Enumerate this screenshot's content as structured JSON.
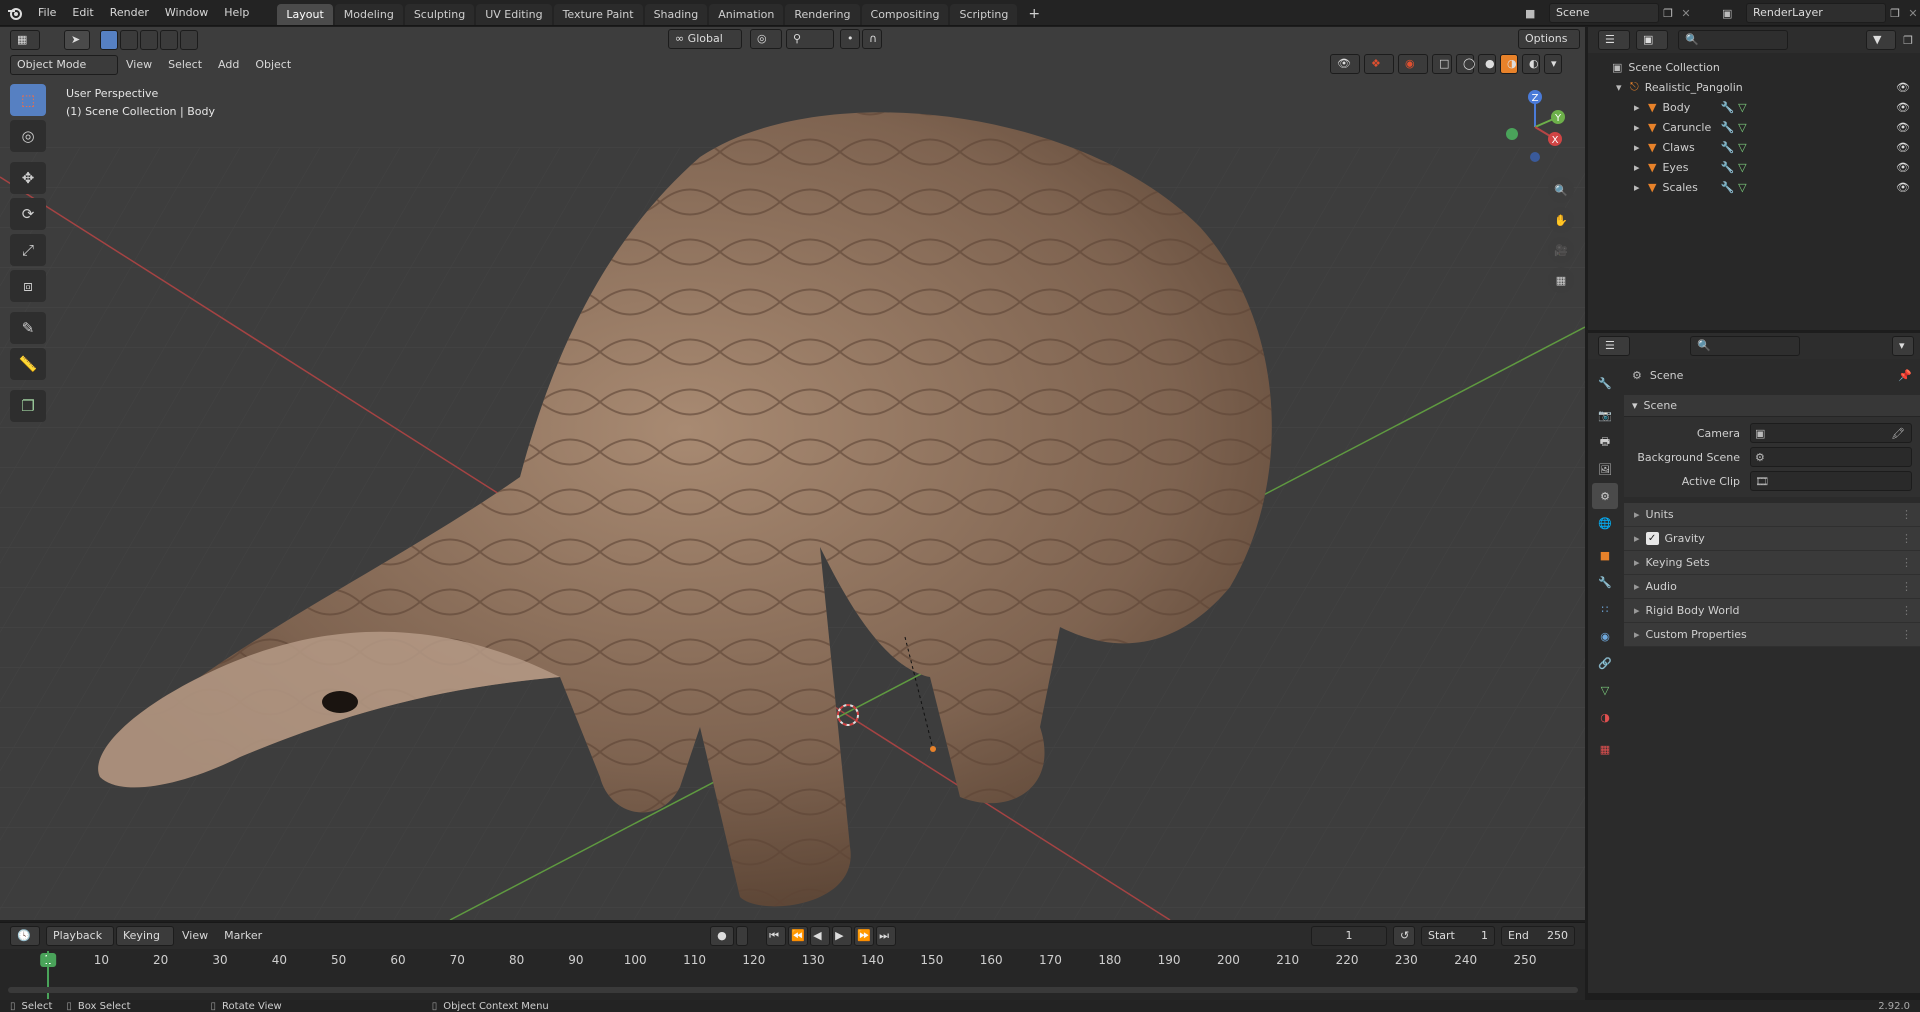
{
  "topbar": {
    "menus": [
      "File",
      "Edit",
      "Render",
      "Window",
      "Help"
    ],
    "tabs": [
      "Layout",
      "Modeling",
      "Sculpting",
      "UV Editing",
      "Texture Paint",
      "Shading",
      "Animation",
      "Rendering",
      "Compositing",
      "Scripting"
    ],
    "add_tab": "+",
    "scene_name": "Scene",
    "render_layer": "RenderLayer"
  },
  "viewport": {
    "mode": "Object Mode",
    "menus": [
      "View",
      "Select",
      "Add",
      "Object"
    ],
    "orientation": "Global",
    "options": "Options",
    "overlay_title": "User Perspective",
    "overlay_subtitle": "(1) Scene Collection | Body",
    "gizmo_axes": [
      "Z",
      "Y",
      "X"
    ]
  },
  "outliner": {
    "root": "Scene Collection",
    "collection": "Realistic_Pangolin",
    "objects": [
      "Body",
      "Caruncle",
      "Claws",
      "Eyes",
      "Scales"
    ]
  },
  "properties": {
    "context": "Scene",
    "panel_title": "Scene",
    "fields": [
      {
        "label": "Camera",
        "value": ""
      },
      {
        "label": "Background Scene",
        "value": ""
      },
      {
        "label": "Active Clip",
        "value": ""
      }
    ],
    "subpanels": [
      "Units",
      "Gravity",
      "Keying Sets",
      "Audio",
      "Rigid Body World",
      "Custom Properties"
    ],
    "gravity_checked": true
  },
  "timeline": {
    "menus": [
      "Playback",
      "Keying",
      "View",
      "Marker"
    ],
    "current_frame": "1",
    "start_label": "Start",
    "start": "1",
    "end_label": "End",
    "end": "250",
    "ticks": [
      "1",
      "10",
      "20",
      "30",
      "40",
      "50",
      "60",
      "70",
      "80",
      "90",
      "100",
      "110",
      "120",
      "130",
      "140",
      "150",
      "160",
      "170",
      "180",
      "190",
      "200",
      "210",
      "220",
      "230",
      "240",
      "250"
    ]
  },
  "statusbar": {
    "select": "Select",
    "box_select": "Box Select",
    "rotate_view": "Rotate View",
    "context_menu": "Object Context Menu",
    "version": "2.92.0"
  },
  "colors": {
    "accent_blue": "#5680c2",
    "active_frame": "#4aa35a",
    "x_axis": "#b54545",
    "y_axis": "#6db04a",
    "z_axis": "#4a7bd9",
    "mesh_icon": "#e8822a"
  }
}
